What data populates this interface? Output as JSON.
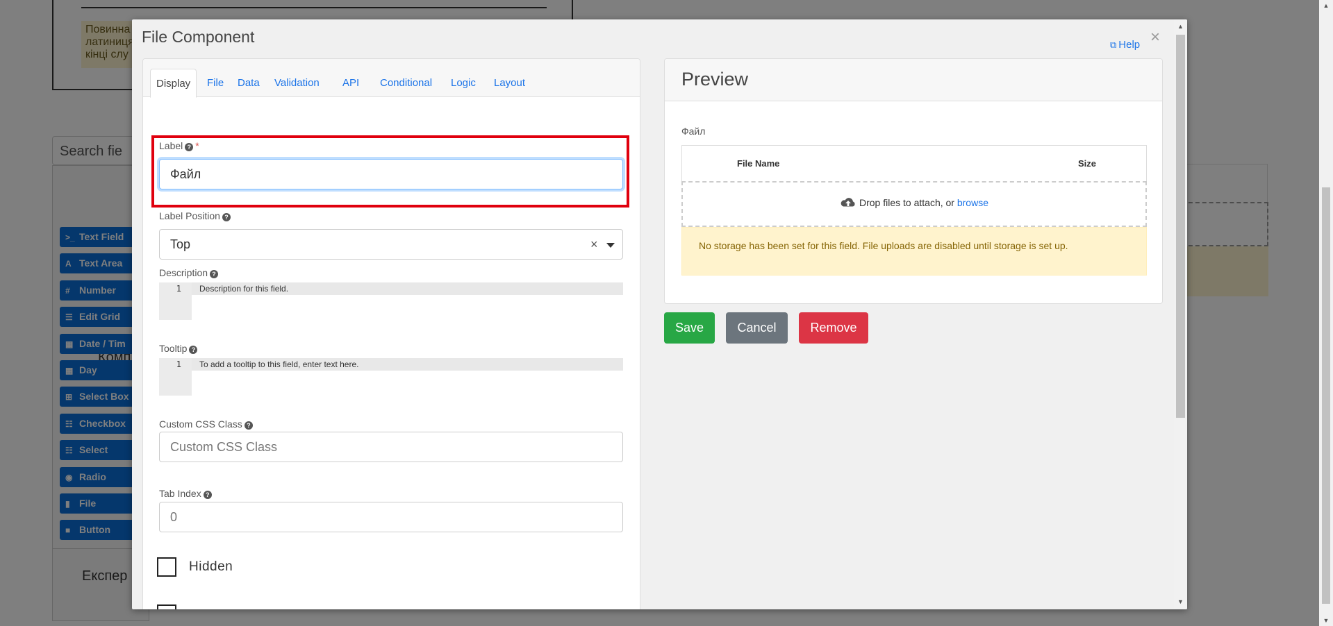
{
  "background": {
    "note_lines": [
      "Повинна",
      "латиниця",
      "кінці слу"
    ],
    "search_placeholder": "Search fie",
    "components_title": "Комп",
    "components": [
      {
        "icon": ">_",
        "label": "Text Field"
      },
      {
        "icon": "A",
        "label": "Text Area"
      },
      {
        "icon": "#",
        "label": "Number"
      },
      {
        "icon": "☰",
        "label": "Edit Grid"
      },
      {
        "icon": "▦",
        "label": "Date / Tim"
      },
      {
        "icon": "▦",
        "label": "Day"
      },
      {
        "icon": "⊞",
        "label": "Select Box"
      },
      {
        "icon": "☷",
        "label": "Checkbox"
      },
      {
        "icon": "☷",
        "label": "Select"
      },
      {
        "icon": "◉",
        "label": "Radio"
      },
      {
        "icon": "▮",
        "label": "File"
      },
      {
        "icon": "■",
        "label": "Button"
      }
    ],
    "expert_title": "Експер"
  },
  "modal": {
    "title": "File Component",
    "help_label": "Help",
    "close_glyph": "×",
    "tabs": [
      "Display",
      "File",
      "Data",
      "Validation",
      "API",
      "Conditional",
      "Logic",
      "Layout"
    ],
    "active_tab": "Display",
    "form": {
      "label": {
        "label": "Label",
        "required_mark": "*",
        "value": "Файл"
      },
      "label_position": {
        "label": "Label Position",
        "value": "Top",
        "clear_glyph": "×"
      },
      "description": {
        "label": "Description",
        "line_number": "1",
        "placeholder": "Description for this field."
      },
      "tooltip": {
        "label": "Tooltip",
        "line_number": "1",
        "placeholder": "To add a tooltip to this field, enter text here."
      },
      "custom_css": {
        "label": "Custom CSS Class",
        "placeholder": "Custom CSS Class"
      },
      "tab_index": {
        "label": "Tab Index",
        "placeholder": "0"
      },
      "hidden": {
        "label": "Hidden",
        "checked": false
      }
    },
    "preview": {
      "title": "Preview",
      "field_label": "Файл",
      "col_file_name": "File Name",
      "col_size": "Size",
      "drop_text": "Drop files to attach, or",
      "browse_text": "browse",
      "warning": "No storage has been set for this field. File uploads are disabled until storage is set up."
    },
    "buttons": {
      "save": "Save",
      "cancel": "Cancel",
      "remove": "Remove"
    }
  },
  "colors": {
    "save": "#28a745",
    "cancel": "#6c757d",
    "remove": "#dc3545",
    "link": "#1a73e8",
    "highlight": "#e0000e",
    "component_button": "#0b6ed9"
  }
}
